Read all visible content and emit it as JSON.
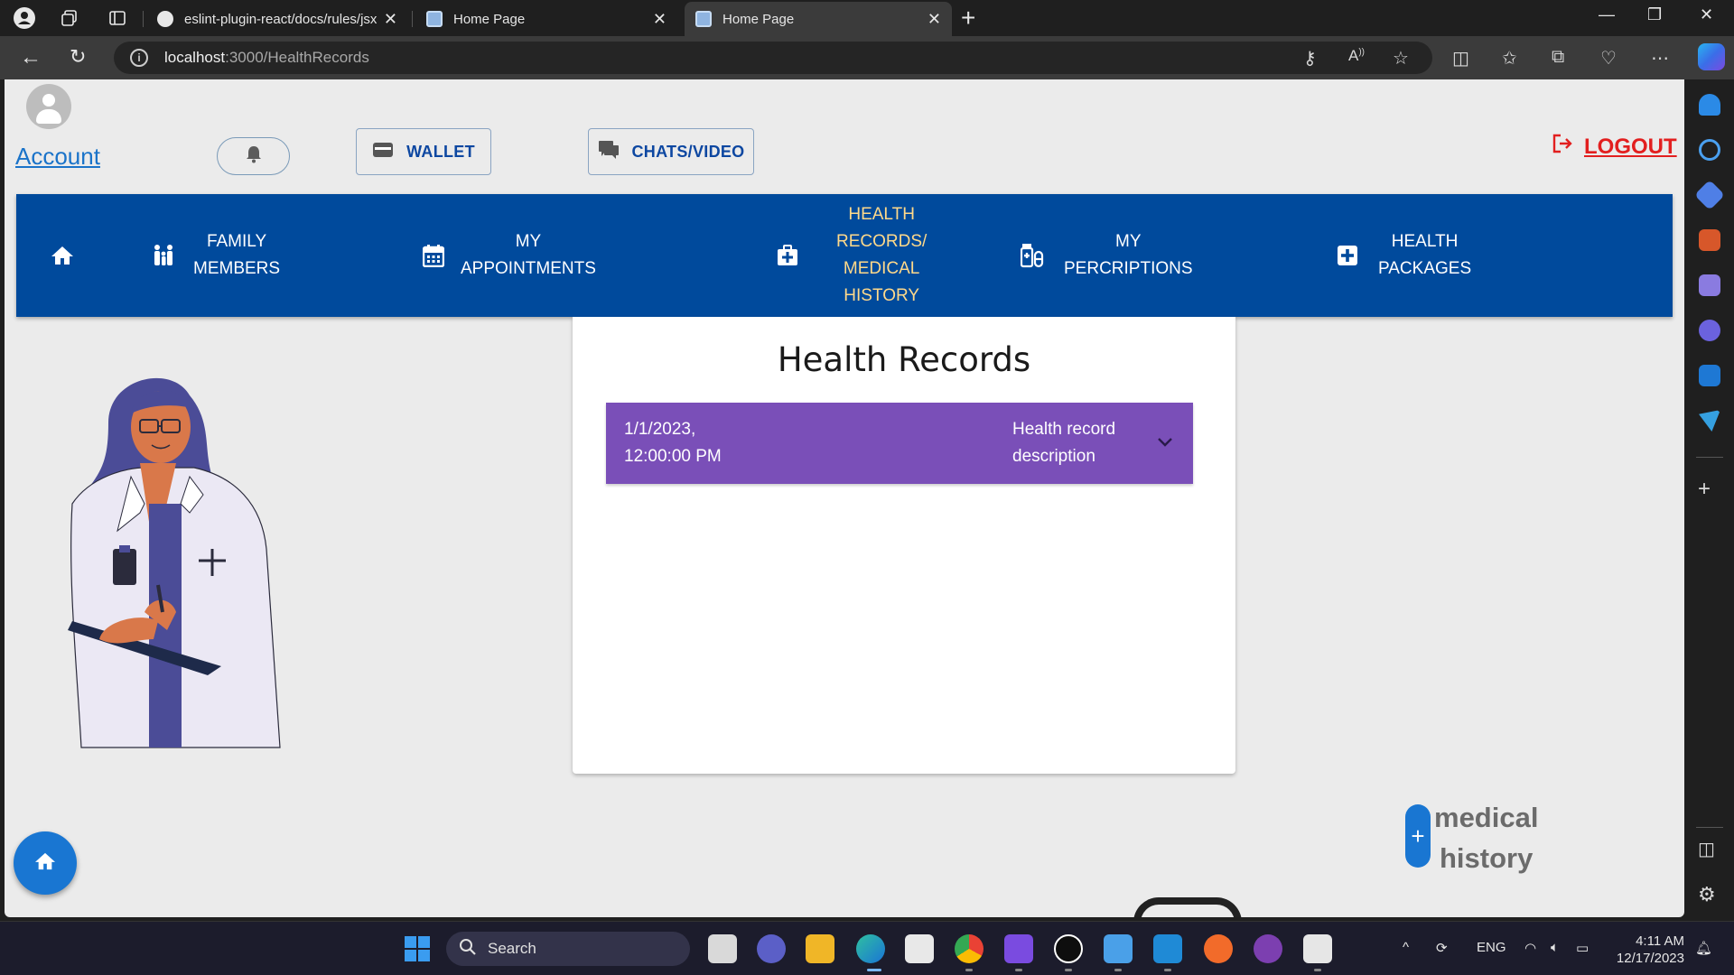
{
  "browser": {
    "tabs": [
      {
        "title": "eslint-plugin-react/docs/rules/jsx",
        "active": false
      },
      {
        "title": "Home Page",
        "active": false
      },
      {
        "title": "Home Page",
        "active": true
      }
    ],
    "url_host": "localhost",
    "url_path": ":3000/HealthRecords"
  },
  "header": {
    "account_label": "Account",
    "wallet_label": "WALLET",
    "chats_label": "CHATS/VIDEO",
    "logout_label": "LOGOUT"
  },
  "nav": {
    "items": [
      {
        "label": "FAMILY MEMBERS",
        "icon": "family-icon"
      },
      {
        "label": "MY APPOINTMENTS",
        "icon": "calendar-icon"
      },
      {
        "label": "HEALTH RECORDS/ MEDICAL HISTORY",
        "icon": "medical-bag-icon",
        "active": true
      },
      {
        "label": "MY PERCRIPTIONS",
        "icon": "prescription-icon"
      },
      {
        "label": "HEALTH PACKAGES",
        "icon": "plus-box-icon"
      }
    ],
    "lines": {
      "family": [
        "FAMILY",
        "MEMBERS"
      ],
      "appointments": [
        "MY",
        "APPOINTMENTS"
      ],
      "records": [
        "HEALTH",
        "RECORDS/",
        "MEDICAL",
        "HISTORY"
      ],
      "prescriptions": [
        "MY",
        "PERCRIPTIONS"
      ],
      "packages": [
        "HEALTH",
        "PACKAGES"
      ]
    }
  },
  "main": {
    "title": "Health Records",
    "records": [
      {
        "date_line1": "1/1/2023,",
        "date_line2": "12:00:00 PM",
        "desc_line1": "Health record",
        "desc_line2": "description"
      }
    ]
  },
  "add_medical_history": {
    "line1": "medical",
    "line2": "history"
  },
  "taskbar": {
    "search_label": "Search",
    "language": "ENG",
    "time": "4:11 AM",
    "date": "12/17/2023"
  },
  "colors": {
    "navbar": "#004a9c",
    "nav_active_text": "#ffd98a",
    "record_row": "#7a4fb8",
    "logout": "#e21f1f",
    "fab": "#1976d2"
  }
}
